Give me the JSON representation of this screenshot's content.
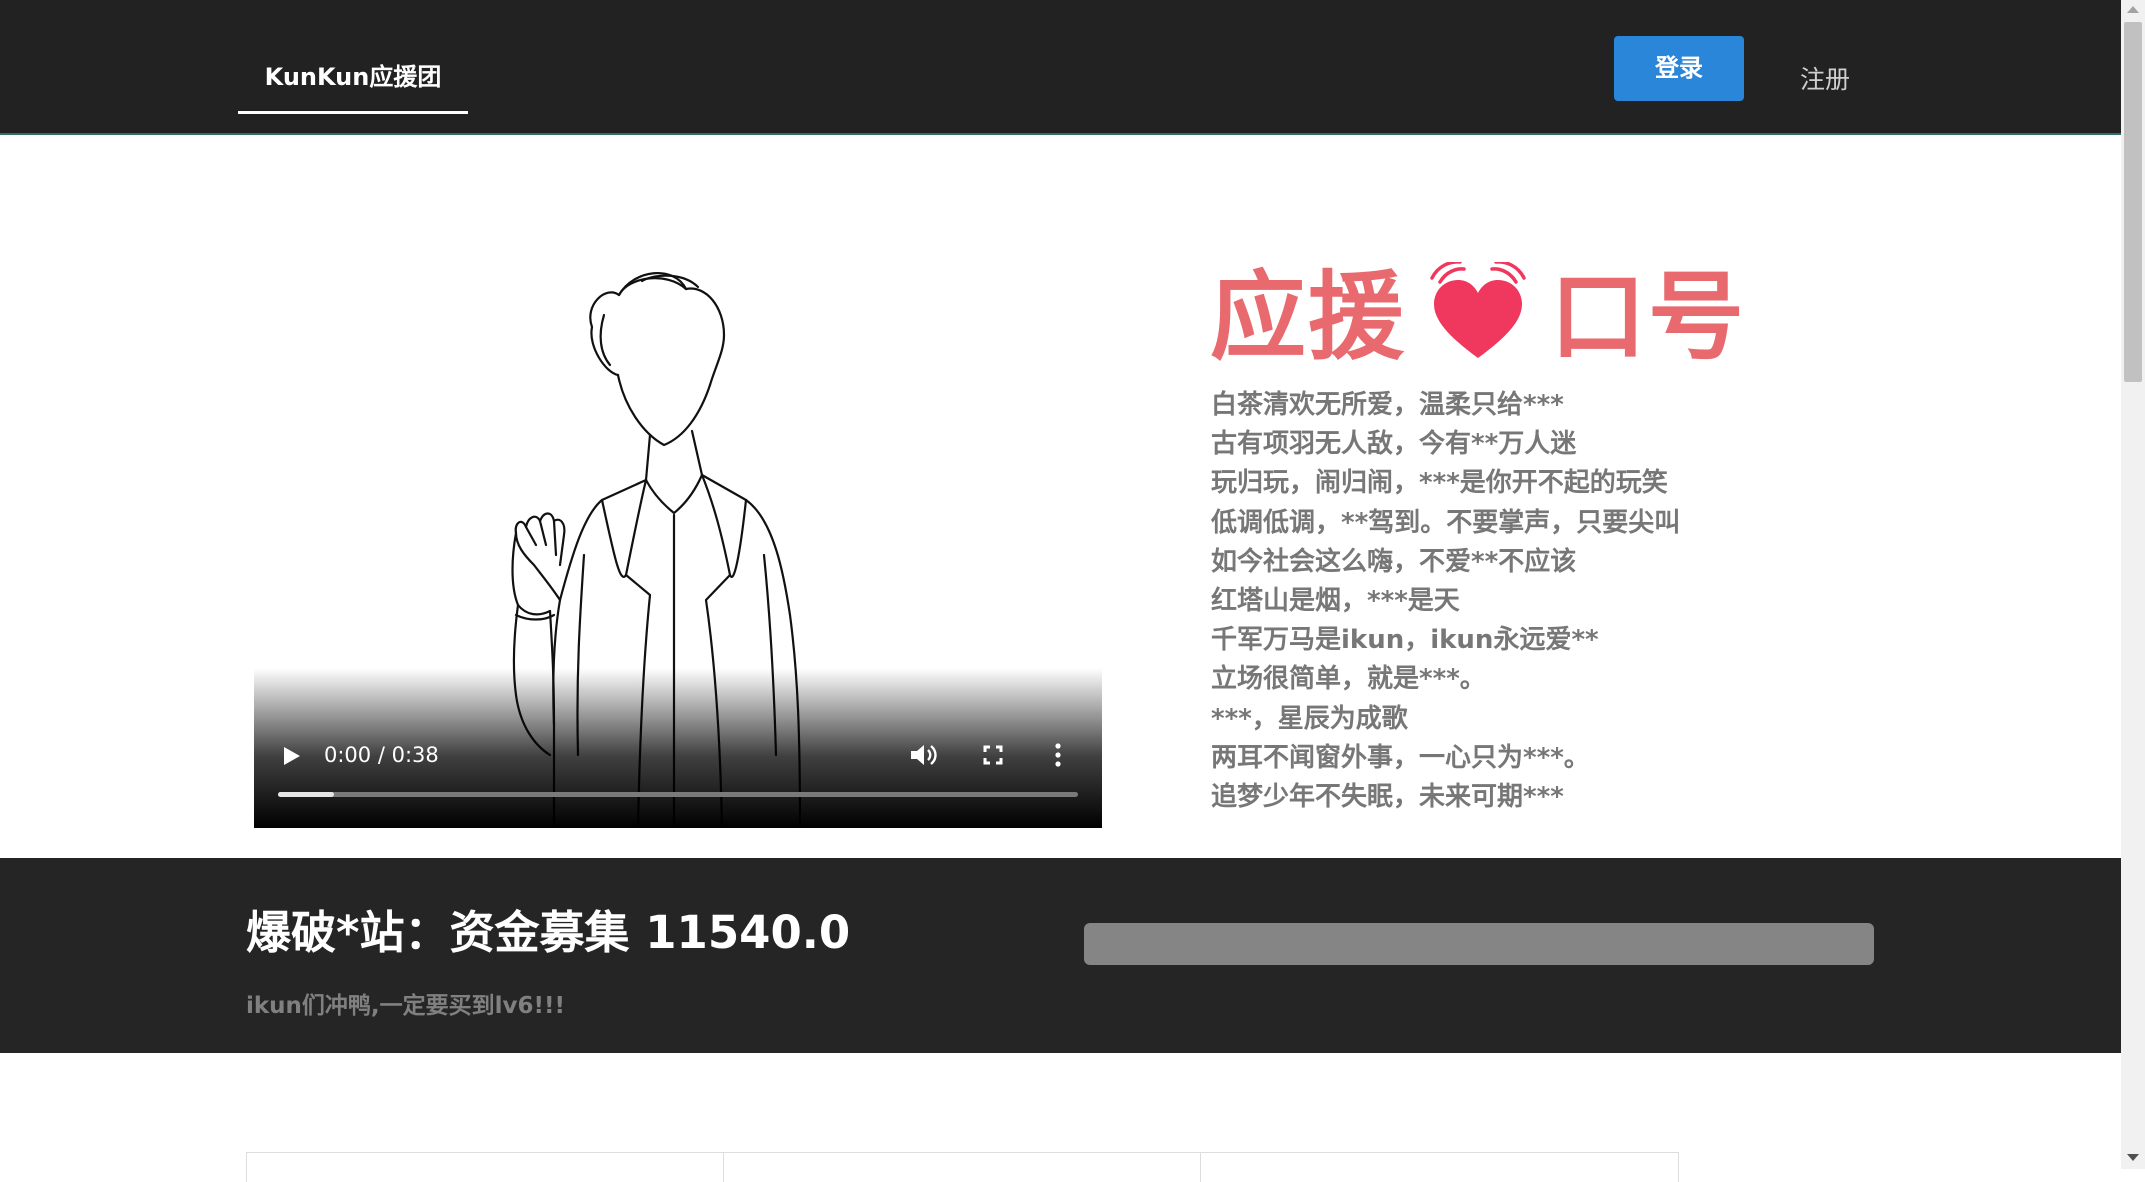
{
  "nav": {
    "brand": "KunKun应援团",
    "login_label": "登录",
    "register_label": "注册"
  },
  "video": {
    "time": "0:00 / 0:38",
    "progress_fraction": 0.07,
    "icons": [
      "play-icon",
      "volume-icon",
      "fullscreen-icon",
      "more-options-icon"
    ]
  },
  "slogan": {
    "title_left": "应援",
    "title_right": "口号",
    "heart_color": "#f0385f",
    "title_color": "#e86a6f",
    "lines": [
      "白茶清欢无所爱，温柔只给***",
      "古有项羽无人敌，今有**万人迷",
      "玩归玩，闹归闹，***是你开不起的玩笑",
      "低调低调，**驾到。不要掌声，只要尖叫",
      "如今社会这么嗨，不爱**不应该",
      "红塔山是烟，***是天",
      "千军万马是ikun，ikun永远爱**",
      "立场很简单，就是***。",
      "***，星辰为成歌",
      "两耳不闻窗外事，一心只为***。",
      "追梦少年不失眠，未来可期***"
    ]
  },
  "funding": {
    "title": "爆破*站：资金募集 11540.0",
    "subtitle": "ikun们冲鸭,一定要买到lv6!!!"
  },
  "colors": {
    "nav_bg": "#222222",
    "login_bg": "#2a86d9",
    "band_bg": "#252525"
  }
}
